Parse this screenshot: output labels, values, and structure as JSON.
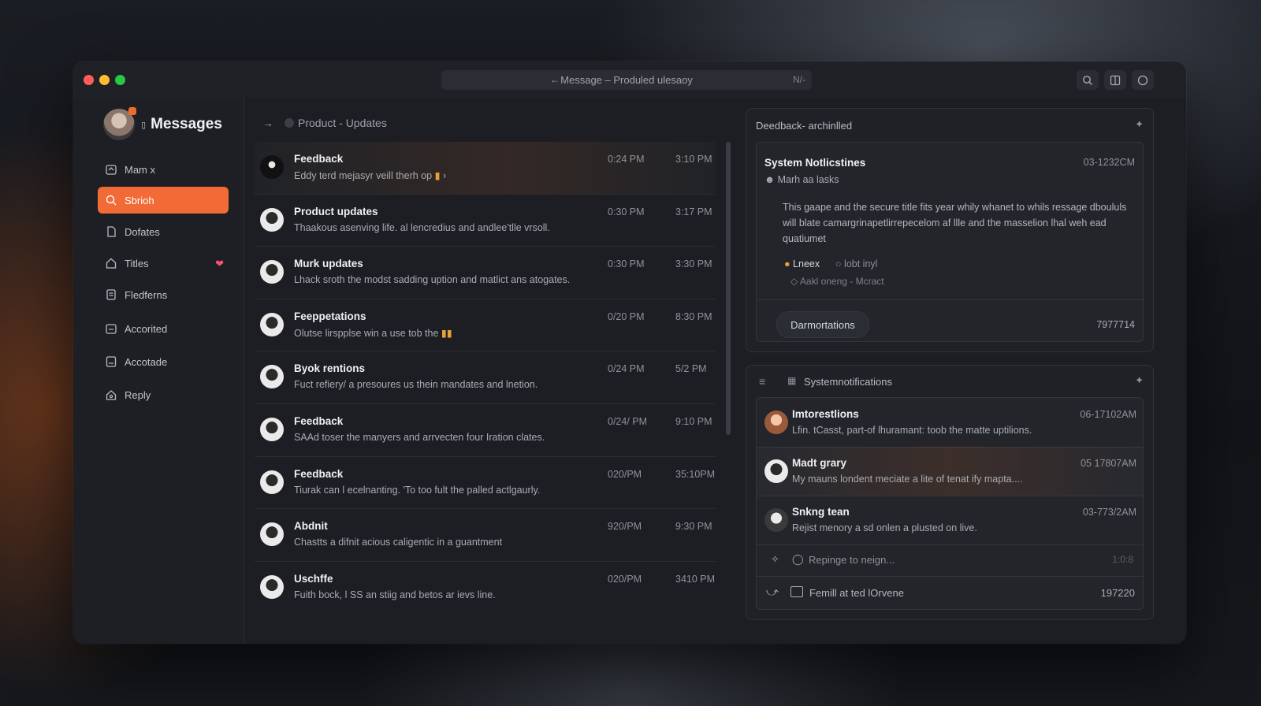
{
  "window": {
    "address": "Message – Produled ulesaoy",
    "address_tail": "N/-"
  },
  "sidebar": {
    "title": "Messages",
    "items": [
      {
        "label": "Mam x",
        "icon": "inbox-icon"
      },
      {
        "label": "Sbrioh",
        "icon": "search-icon",
        "active": true
      },
      {
        "label": "Dofates",
        "icon": "file-icon"
      },
      {
        "label": "Titles",
        "icon": "home-icon",
        "badge": "heart"
      },
      {
        "label": "Fledferns",
        "icon": "list-icon"
      },
      {
        "label": "Accorited",
        "icon": "folder-icon"
      },
      {
        "label": "Accotade",
        "icon": "document-icon"
      },
      {
        "label": "Reply",
        "icon": "reply-icon"
      }
    ]
  },
  "main": {
    "breadcrumb": "Product - Updates",
    "messages": [
      {
        "title": "Feedback",
        "preview": "Eddy terd mejasyr veill therh op",
        "time1": "0:24 PM",
        "time2": "3:10 PM"
      },
      {
        "title": "Product updates",
        "preview": "Thaakous asenving life. al lencredius and andlee'tlle vrsoll.",
        "time1": "0:30 PM",
        "time2": "3:17 PM"
      },
      {
        "title": "Murk updates",
        "preview": "Lhack sroth the modst sadding uption and matlict ans atogates.",
        "time1": "0:30 PM",
        "time2": "3:30 PM"
      },
      {
        "title": "Feeppetations",
        "preview": "Olutse lirspplse win a use tob the",
        "time1": "0/20 PM",
        "time2": "8:30 PM"
      },
      {
        "title": "Byok rentions",
        "preview": "Fuct refiery/ a presoures us thein mandates and lnetion.",
        "time1": "0/24 PM",
        "time2": "5/2 PM"
      },
      {
        "title": "Feedback",
        "preview": "SAAd toser the manyers and arrvecten four Iration clates.",
        "time1": "0/24/ PM",
        "time2": "9:10 PM"
      },
      {
        "title": "Feedback",
        "preview": "Tiurak can l ecelnanting. 'To too fult the palled actlgaurly.",
        "time1": "020/PM",
        "time2": "35:10PM"
      },
      {
        "title": "Abdnit",
        "preview": "Chastts a difnit acious caligentic in a guantment",
        "time1": "920/PM",
        "time2": "9:30 PM"
      },
      {
        "title": "Uschffe",
        "preview": "Fuith bock, l SS an stiig and betos ar ievs line.",
        "time1": "020/PM",
        "time2": "3410 PM"
      }
    ]
  },
  "right": {
    "card1": {
      "header": "Deedback- archinlled",
      "system_title": "System Notlicstines",
      "system_time": "03-1232CM",
      "system_sub": "Marh aa lasks",
      "body": "This gaape and the secure title fits year whily whanet to whils ressage dboululs will blate camargrinapetlirrepecelom af llle and the masselion lhal weh ead quatiumet",
      "tag1": "Lneex",
      "tag2": "lobt inyl",
      "tag3": "Aakl oneng - Mcract",
      "button": "Darmortations",
      "count": "7977714"
    },
    "card2": {
      "header": "Systemnotifications",
      "rows": [
        {
          "title": "Imtorestlions",
          "preview": "Lfin. tCasst, part-of lhuramant: toob the matte uptilions.",
          "time": "06-17102AM"
        },
        {
          "title": "Madt grary",
          "preview": "My mauns londent meciate a lite of tenat ify mapta....",
          "time": "05 17807AM"
        },
        {
          "title": "Snkng tean",
          "preview": "Rejist menory a sd onlen a plusted on live.",
          "time": "03-773/2AM"
        }
      ],
      "reply_placeholder": "Repinge to neign...",
      "reply_right": "1:0:8",
      "footer_text": "Femill at ted lOrvene",
      "footer_count": "197220"
    }
  },
  "colors": {
    "accent": "#f26a35",
    "heart": "#ff4f6e",
    "window": "#1c1e23"
  }
}
